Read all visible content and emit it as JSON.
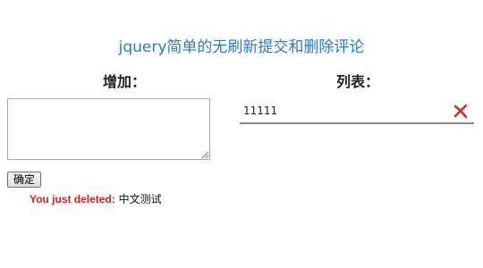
{
  "page": {
    "title": "jquery简单的无刷新提交和删除评论"
  },
  "add_panel": {
    "heading": "增加：",
    "comment_value": "",
    "submit_label": "确定"
  },
  "status": {
    "deleted_prefix": "You just deleted:",
    "deleted_value": "中文测试"
  },
  "list_panel": {
    "heading": "列表：",
    "items": [
      {
        "text": "11111",
        "delete_icon": "red-x-icon"
      }
    ]
  },
  "colors": {
    "title": "#2a7ac7",
    "status_prefix": "#e01b1b",
    "delete_icon": "#d42a2a"
  }
}
